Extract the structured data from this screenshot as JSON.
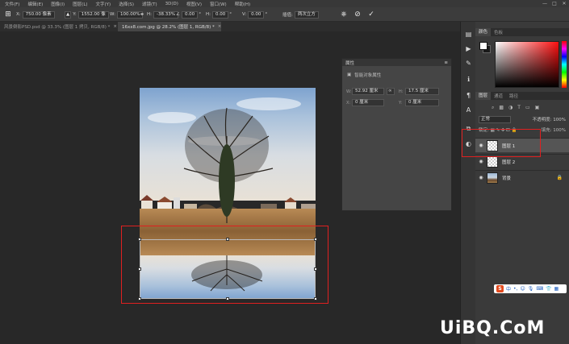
{
  "menu": [
    "文件(F)",
    "编辑(E)",
    "图像(I)",
    "图层(L)",
    "文字(Y)",
    "选择(S)",
    "滤镜(T)",
    "3D(D)",
    "视图(V)",
    "窗口(W)",
    "帮助(H)"
  ],
  "window_controls": [
    "—",
    "□",
    "✕"
  ],
  "options": {
    "x_label": "X:",
    "x_value": "750.00 像素",
    "y_label": "Y:",
    "y_value": "1552.00 像",
    "w_label": "W:",
    "w_value": "100.00%",
    "h_label": "H:",
    "h_value": "-38.33%",
    "angle_value": "0.00",
    "hskew_label": "H:",
    "hskew_value": "0.00",
    "vskew_label": "V:",
    "vskew_value": "0.00",
    "interp_label": "插值:",
    "interp_value": "两次立方"
  },
  "tabs": [
    {
      "label": "风景倒影PSD.psd @ 33.3% (图层 1 拷贝, RGB/8) *",
      "active": false
    },
    {
      "label": "16xx8.com.jpg @ 28.2% (图层 1, RGB/8) *",
      "active": true
    }
  ],
  "color_panel": {
    "tabs": [
      "颜色",
      "色板"
    ]
  },
  "properties": {
    "title": "属性",
    "subtitle": "智能对象属性",
    "w_label": "W:",
    "w_value": "52.92 厘米",
    "h_label": "H:",
    "h_value": "17.5 厘米",
    "x_label": "X:",
    "x_value": "0 厘米",
    "y_label": "Y:",
    "y_value": "0 厘米"
  },
  "layers_panel": {
    "tabs": [
      "图层",
      "通道",
      "路径"
    ],
    "blend_mode": "正常",
    "opacity_label": "不透明度:",
    "opacity_value": "100%",
    "lock_label": "锁定:",
    "fill_label": "填充:",
    "fill_value": "100%",
    "layers": [
      {
        "name": "图层 1",
        "selected": true,
        "thumb": "checker",
        "locked": false
      },
      {
        "name": "图层 2",
        "selected": false,
        "thumb": "checker",
        "locked": false
      },
      {
        "name": "背景",
        "selected": false,
        "thumb": "photo",
        "locked": true
      }
    ]
  },
  "ime": {
    "logo": "S",
    "label": "中"
  },
  "watermark": "UiBQ.CoM",
  "colors": {
    "selection_outline": "#e02020",
    "foreground": "#ffffff",
    "background": "#1a1a1a"
  }
}
